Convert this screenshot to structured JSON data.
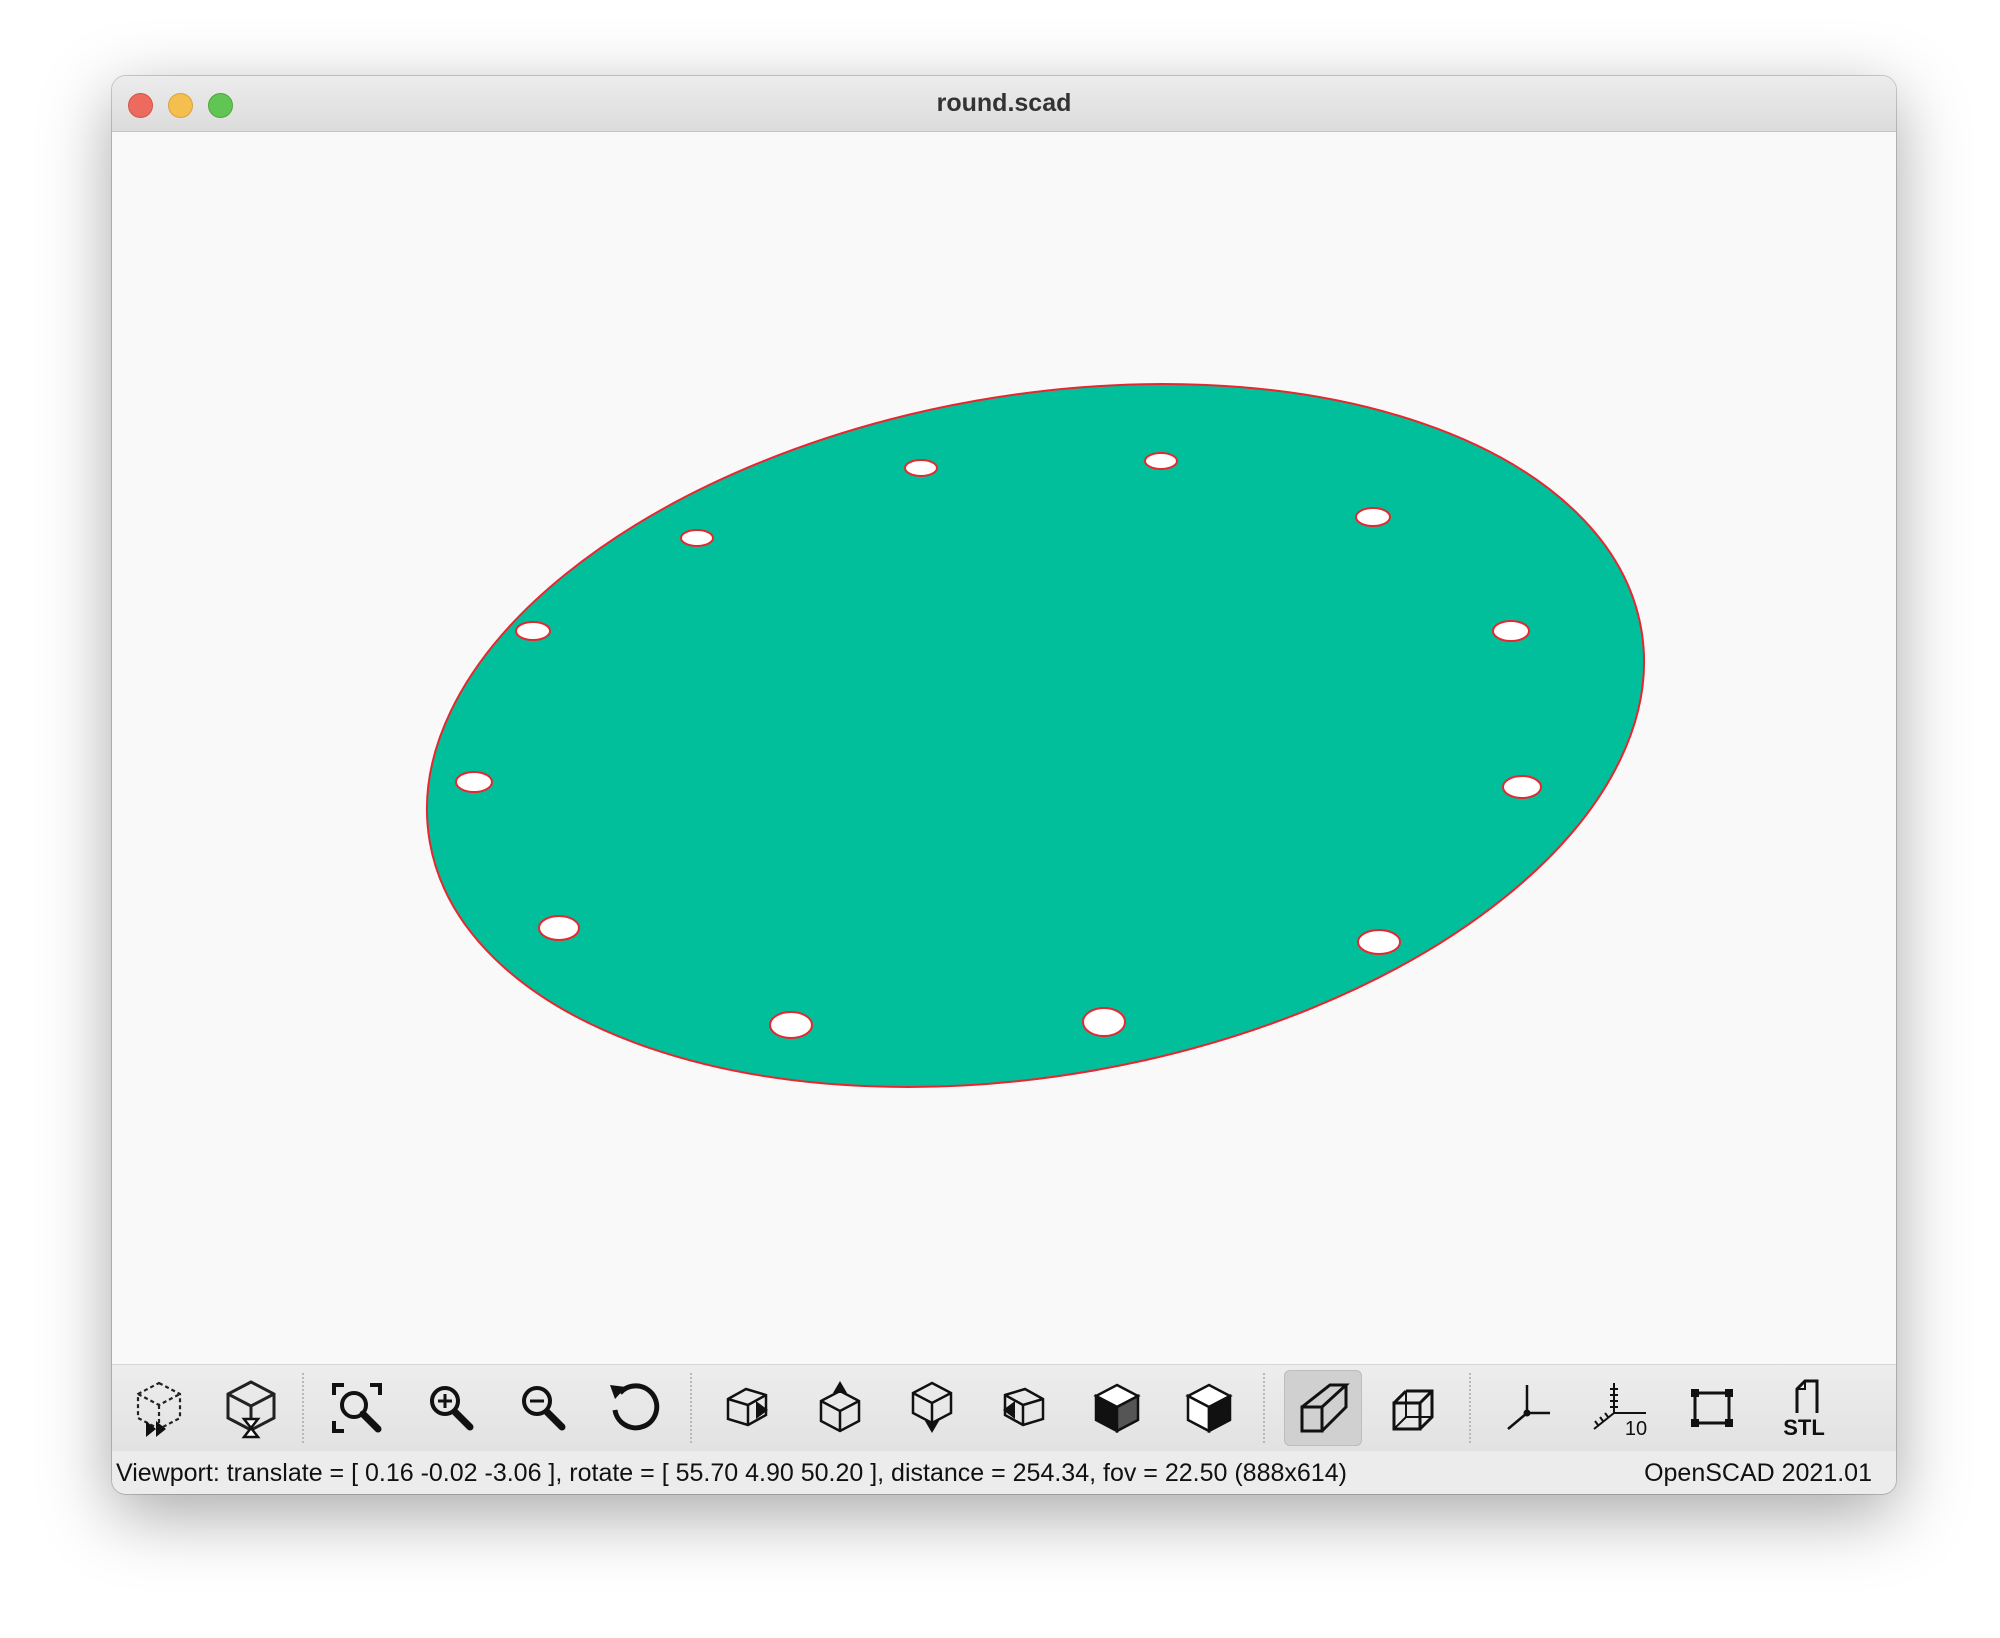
{
  "window": {
    "title": "round.scad"
  },
  "model": {
    "fill_color": "#00bf9a",
    "edge_color": "#e8262f",
    "hole_color": "#ffffff"
  },
  "toolbar": {
    "buttons": [
      {
        "name": "preview-button",
        "icon": "cube-dashed-fast-forward-icon"
      },
      {
        "name": "render-button",
        "icon": "cube-hourglass-icon"
      },
      {
        "name": "view-all-button",
        "icon": "zoom-fit-icon"
      },
      {
        "name": "zoom-in-button",
        "icon": "zoom-in-icon"
      },
      {
        "name": "zoom-out-icon-button",
        "icon": "zoom-out-icon"
      },
      {
        "name": "reset-view-button",
        "icon": "rotate-ccw-icon"
      },
      {
        "name": "view-right-button",
        "icon": "cube-right-icon"
      },
      {
        "name": "view-top-button",
        "icon": "cube-top-icon"
      },
      {
        "name": "view-bottom-button",
        "icon": "cube-bottom-icon"
      },
      {
        "name": "view-left-button",
        "icon": "cube-left-icon"
      },
      {
        "name": "view-front-button",
        "icon": "cube-front-icon"
      },
      {
        "name": "view-back-button",
        "icon": "cube-back-icon"
      },
      {
        "name": "perspective-button",
        "icon": "perspective-icon",
        "active": true
      },
      {
        "name": "orthogonal-button",
        "icon": "orthogonal-icon"
      },
      {
        "name": "show-axes-button",
        "icon": "axes-icon"
      },
      {
        "name": "show-scale-markers-button",
        "icon": "scale-markers-icon",
        "label": "10"
      },
      {
        "name": "show-edges-button",
        "icon": "edges-icon"
      },
      {
        "name": "export-stl-button",
        "icon": "stl-icon",
        "label": "STL"
      }
    ]
  },
  "status": {
    "viewport": "Viewport: translate = [ 0.16 -0.02 -3.06 ], rotate = [ 55.70 4.90 50.20 ], distance = 254.34, fov = 22.50 (888x614)",
    "version": "OpenSCAD 2021.01"
  }
}
